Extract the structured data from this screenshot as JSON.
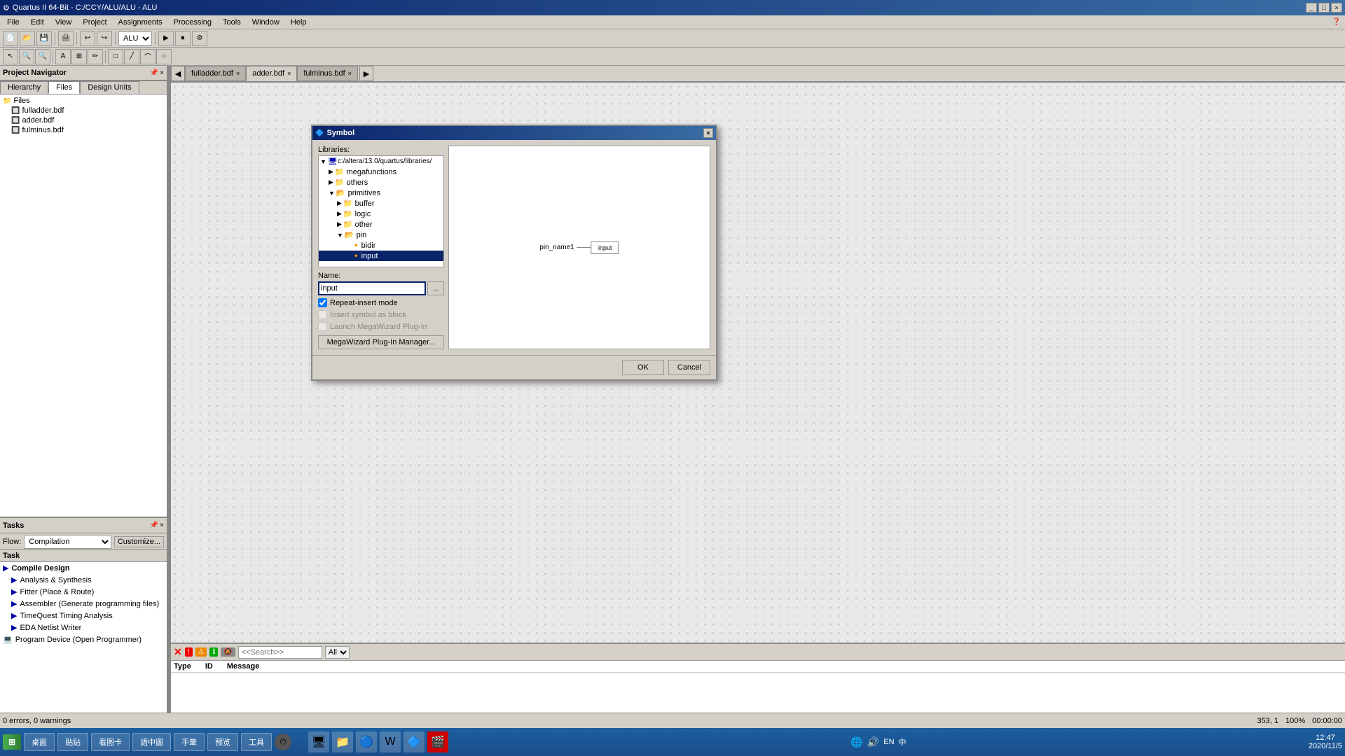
{
  "titleBar": {
    "title": "Quartus II 64-Bit - C:/CCY/ALU/ALU - ALU",
    "buttons": [
      "_",
      "□",
      "×"
    ]
  },
  "menuBar": {
    "items": [
      "File",
      "Edit",
      "View",
      "Project",
      "Assignments",
      "Processing",
      "Tools",
      "Window",
      "Help"
    ]
  },
  "toolbar1": {
    "dropdown": "ALU"
  },
  "projectNavigator": {
    "title": "Project Navigator",
    "tabs": [
      "Hierarchy",
      "Files",
      "Design Units"
    ],
    "activeTab": "Files",
    "files": [
      {
        "name": "Files",
        "isRoot": true
      },
      {
        "name": "fulladder.bdf",
        "icon": "📄",
        "indent": 1
      },
      {
        "name": "adder.bdf",
        "icon": "📄",
        "indent": 1
      },
      {
        "name": "fulminus.bdf",
        "icon": "📄",
        "indent": 1
      }
    ]
  },
  "tasks": {
    "title": "Tasks",
    "flow": {
      "label": "Flow:",
      "value": "Compilation",
      "customizeLabel": "Customize..."
    },
    "columnHeader": "Task",
    "items": [
      {
        "label": "Compile Design",
        "indent": 0,
        "arrow": "▶",
        "bold": true
      },
      {
        "label": "Analysis & Synthesis",
        "indent": 1,
        "arrow": "▶"
      },
      {
        "label": "Fitter (Place & Route)",
        "indent": 1,
        "arrow": "▶"
      },
      {
        "label": "Assembler (Generate programming files)",
        "indent": 1,
        "arrow": "▶"
      },
      {
        "label": "TimeQuest Timing Analysis",
        "indent": 1,
        "arrow": "▶"
      },
      {
        "label": "EDA Netlist Writer",
        "indent": 1,
        "arrow": "▶"
      },
      {
        "label": "Program Device (Open Programmer)",
        "indent": 0,
        "icon": "💻"
      }
    ]
  },
  "centralTabs": [
    {
      "label": "fulladder.bdf",
      "active": false,
      "closeable": true
    },
    {
      "label": "adder.bdf",
      "active": true,
      "closeable": true
    },
    {
      "label": "fulminus.bdf",
      "active": false,
      "closeable": true
    }
  ],
  "symbolDialog": {
    "title": "Symbol",
    "librariesLabel": "Libraries:",
    "treeNodes": [
      {
        "label": "c:/altera/13.0/quartus/libraries/",
        "indent": 0,
        "expanded": true,
        "type": "root"
      },
      {
        "label": "megafunctions",
        "indent": 1,
        "expanded": false,
        "type": "folder"
      },
      {
        "label": "others",
        "indent": 1,
        "expanded": false,
        "type": "folder"
      },
      {
        "label": "primitives",
        "indent": 1,
        "expanded": true,
        "type": "folder"
      },
      {
        "label": "buffer",
        "indent": 2,
        "expanded": false,
        "type": "folder"
      },
      {
        "label": "logic",
        "indent": 2,
        "expanded": false,
        "type": "folder"
      },
      {
        "label": "other",
        "indent": 2,
        "expanded": false,
        "type": "folder"
      },
      {
        "label": "pin",
        "indent": 2,
        "expanded": true,
        "type": "folder"
      },
      {
        "label": "bidir",
        "indent": 3,
        "expanded": false,
        "type": "file"
      },
      {
        "label": "input",
        "indent": 3,
        "expanded": false,
        "type": "file",
        "selected": true
      }
    ],
    "nameLabel": "Name:",
    "nameValue": "input",
    "namePlaceholder": "",
    "checkboxes": [
      {
        "label": "Repeat-insert mode",
        "checked": true,
        "enabled": true
      },
      {
        "label": "Insert symbol as block",
        "checked": false,
        "enabled": false
      },
      {
        "label": "Launch MegaWizard Plug-In",
        "checked": false,
        "enabled": false
      }
    ],
    "megawizardBtn": "MegaWizard Plug-In Manager...",
    "okBtn": "OK",
    "cancelBtn": "Cancel",
    "preview": {
      "pinName": "pin_name1",
      "pinLabel": "input"
    }
  },
  "logArea": {
    "searchPlaceholder": "<<Search>>",
    "columns": [
      "Type",
      "ID",
      "Message"
    ]
  },
  "statusBar": {
    "coords": "353, 1",
    "zoom": "100%",
    "time": "00:00:00"
  },
  "taskbar": {
    "buttons": [
      "桌面",
      "贴贴",
      "看图卡",
      "語中圖",
      "手筆",
      "预览",
      "工具"
    ],
    "clock": "12:47",
    "date": "2020/11/5"
  }
}
